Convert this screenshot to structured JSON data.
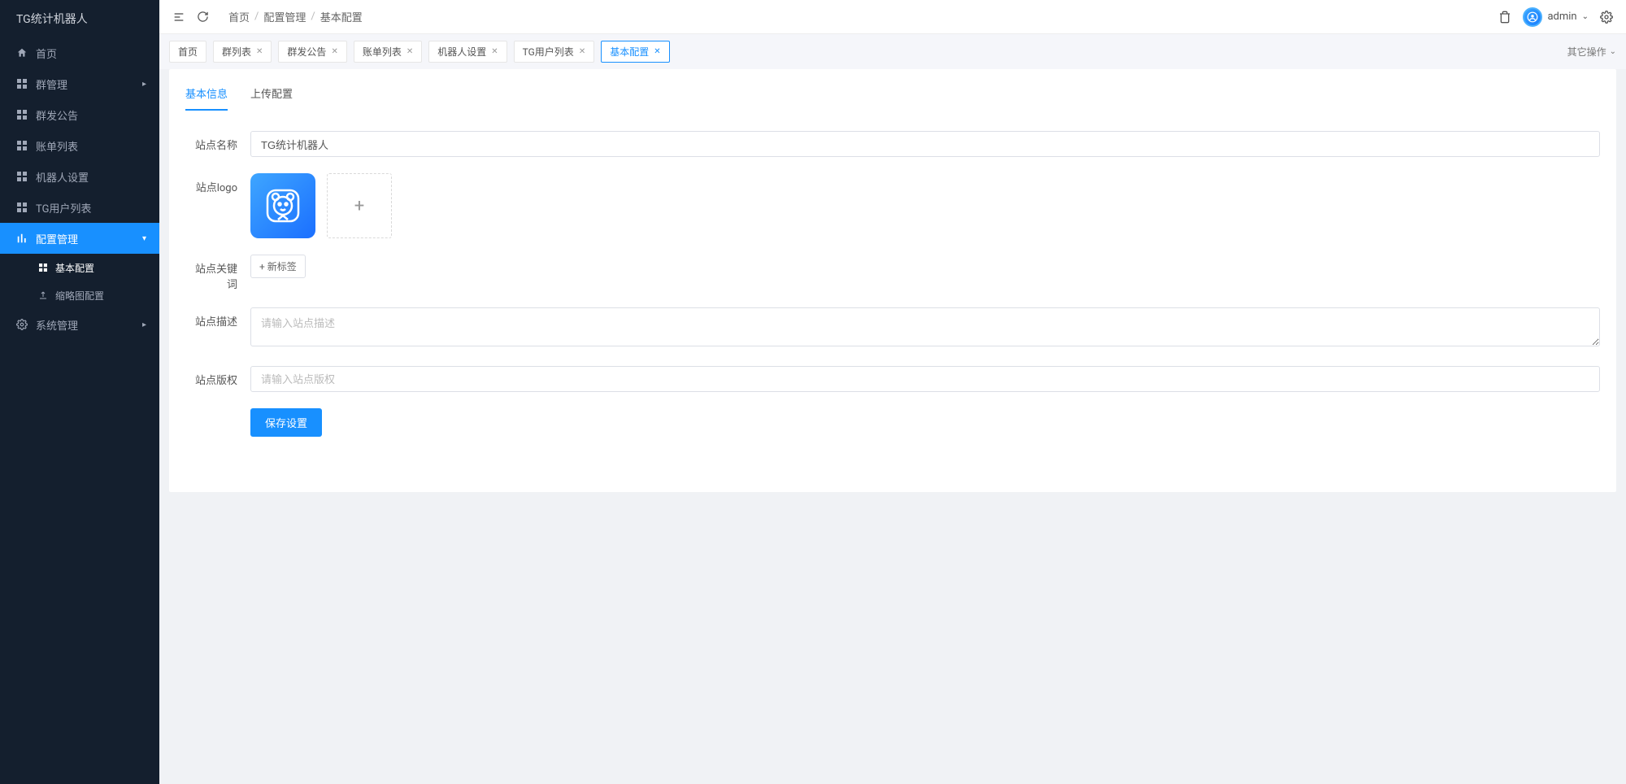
{
  "app": {
    "title": "TG统计机器人"
  },
  "sidebar": {
    "items": [
      {
        "label": "首页",
        "icon": "home"
      },
      {
        "label": "群管理",
        "icon": "grid",
        "expandable": true
      },
      {
        "label": "群发公告",
        "icon": "grid"
      },
      {
        "label": "账单列表",
        "icon": "grid"
      },
      {
        "label": "机器人设置",
        "icon": "grid"
      },
      {
        "label": "TG用户列表",
        "icon": "grid"
      },
      {
        "label": "配置管理",
        "icon": "bars",
        "expandable": true,
        "active": true,
        "children": [
          {
            "label": "基本配置",
            "icon": "grid",
            "active": true
          },
          {
            "label": "缩略图配置",
            "icon": "upload"
          }
        ]
      },
      {
        "label": "系统管理",
        "icon": "gear",
        "expandable": true
      }
    ]
  },
  "header": {
    "breadcrumb": [
      "首页",
      "配置管理",
      "基本配置"
    ],
    "user": "admin"
  },
  "tabs": {
    "items": [
      {
        "label": "首页",
        "closable": false
      },
      {
        "label": "群列表",
        "closable": true
      },
      {
        "label": "群发公告",
        "closable": true
      },
      {
        "label": "账单列表",
        "closable": true
      },
      {
        "label": "机器人设置",
        "closable": true
      },
      {
        "label": "TG用户列表",
        "closable": true
      },
      {
        "label": "基本配置",
        "closable": true,
        "active": true
      }
    ],
    "actions_label": "其它操作"
  },
  "inner_tabs": {
    "items": [
      {
        "label": "基本信息",
        "active": true
      },
      {
        "label": "上传配置"
      }
    ]
  },
  "form": {
    "site_name": {
      "label": "站点名称",
      "value": "TG统计机器人"
    },
    "site_logo": {
      "label": "站点logo"
    },
    "site_keywords": {
      "label": "站点关键词",
      "add_tag": "+ 新标签"
    },
    "site_desc": {
      "label": "站点描述",
      "placeholder": "请输入站点描述",
      "value": ""
    },
    "site_copyright": {
      "label": "站点版权",
      "placeholder": "请输入站点版权",
      "value": ""
    },
    "submit": "保存设置"
  }
}
